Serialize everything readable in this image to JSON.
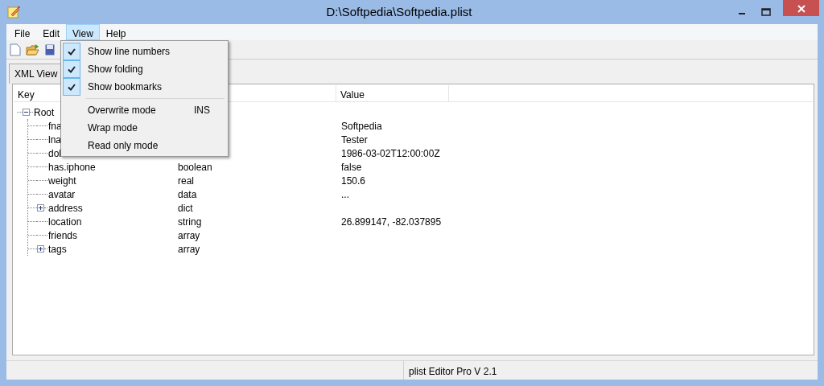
{
  "window": {
    "title": "D:\\Softpedia\\Softpedia.plist"
  },
  "menu_bar": [
    {
      "label": "File",
      "selected": false
    },
    {
      "label": "Edit",
      "selected": false
    },
    {
      "label": "View",
      "selected": true
    },
    {
      "label": "Help",
      "selected": false
    }
  ],
  "view_menu": [
    {
      "kind": "item",
      "label": "Show line numbers",
      "checked": true
    },
    {
      "kind": "item",
      "label": "Show folding",
      "checked": true
    },
    {
      "kind": "item",
      "label": "Show bookmarks",
      "checked": true
    },
    {
      "kind": "separator"
    },
    {
      "kind": "item",
      "label": "Overwrite mode",
      "checked": false,
      "shortcut": "INS"
    },
    {
      "kind": "item",
      "label": "Wrap mode",
      "checked": false
    },
    {
      "kind": "item",
      "label": "Read only mode",
      "checked": false
    }
  ],
  "tabs": [
    {
      "label": "XML View",
      "selected": false
    }
  ],
  "table": {
    "columns": [
      "Key",
      "Value"
    ],
    "rows": [
      {
        "key": "Root",
        "expanded": true,
        "children": [
          {
            "key": "fna",
            "value": "Softpedia"
          },
          {
            "key": "lna",
            "value": "Tester"
          },
          {
            "key": "dol",
            "value": "1986-03-02T12:00:00Z"
          },
          {
            "key": "has.iphone",
            "type": "boolean",
            "value": "false"
          },
          {
            "key": "weight",
            "type": "real",
            "value": "150.6"
          },
          {
            "key": "avatar",
            "type": "data",
            "value": "..."
          },
          {
            "key": "address",
            "type": "dict",
            "expanded": false
          },
          {
            "key": "location",
            "type": "string",
            "value": "26.899147, -82.037895"
          },
          {
            "key": "friends",
            "type": "array"
          },
          {
            "key": "tags",
            "type": "array",
            "expanded": false
          }
        ]
      }
    ]
  },
  "status_bar": {
    "text": "plist Editor Pro V 2.1"
  }
}
